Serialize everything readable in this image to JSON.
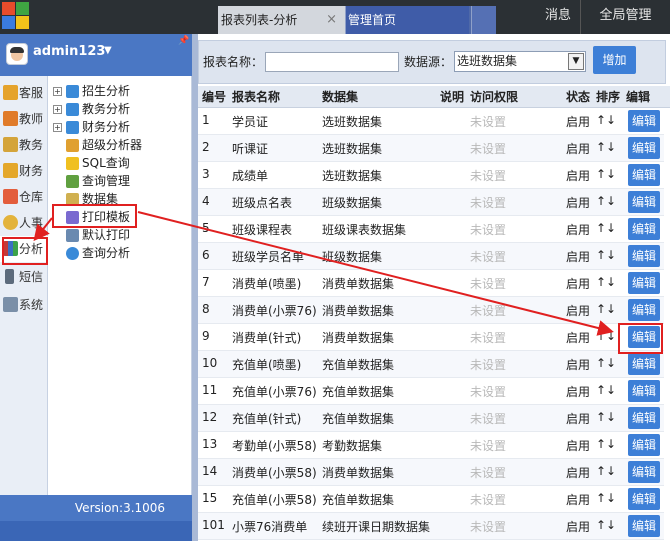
{
  "topbar": {
    "tabs": [
      {
        "label": "报表列表-分析",
        "close": "×",
        "active": true
      },
      {
        "label": "管理首页",
        "active": false
      }
    ],
    "links": {
      "messages": "消息",
      "settings": "全局管理"
    },
    "colors": {
      "background": "#2b3034",
      "active_tab": "#d3d7dd",
      "inactive_tab": "#3f5ca8"
    }
  },
  "user": {
    "name": "admin123",
    "dropdown_icon": "triangle-down-icon",
    "pin_icon": "pin-icon"
  },
  "sidebar": {
    "nav": [
      {
        "label": "客服",
        "icon": "customer-service-icon",
        "color": "#e5a32c"
      },
      {
        "label": "教师",
        "icon": "teacher-icon",
        "color": "#e07b2a"
      },
      {
        "label": "教务",
        "icon": "academic-icon",
        "color": "#d4a43a"
      },
      {
        "label": "财务",
        "icon": "finance-icon",
        "color": "#e4a72a"
      },
      {
        "label": "仓库",
        "icon": "warehouse-icon",
        "color": "#e35d3c"
      },
      {
        "label": "人事",
        "icon": "hr-icon",
        "color": "#e3b33b"
      },
      {
        "label": "分析",
        "icon": "analysis-icon",
        "color": "#c23a3a",
        "active": true
      },
      {
        "label": "短信",
        "icon": "sms-icon",
        "color": "#5d6b7c"
      },
      {
        "label": "系统",
        "icon": "system-icon",
        "color": "#7a8fa8"
      }
    ],
    "tree": [
      {
        "label": "招生分析",
        "expandable": true,
        "icon": "enrollment-analysis-icon"
      },
      {
        "label": "教务分析",
        "expandable": true,
        "icon": "academic-analysis-icon"
      },
      {
        "label": "财务分析",
        "expandable": true,
        "icon": "finance-analysis-icon"
      },
      {
        "label": "超级分析器",
        "expandable": false,
        "icon": "super-analyzer-icon"
      },
      {
        "label": "SQL查询",
        "expandable": false,
        "icon": "sql-query-icon"
      },
      {
        "label": "查询管理",
        "expandable": false,
        "icon": "query-management-icon"
      },
      {
        "label": "数据集",
        "expandable": false,
        "icon": "dataset-icon"
      },
      {
        "label": "打印模板",
        "expandable": false,
        "icon": "print-template-icon",
        "active": true
      },
      {
        "label": "默认打印",
        "expandable": false,
        "icon": "default-print-icon"
      },
      {
        "label": "查询分析",
        "expandable": false,
        "icon": "query-analysis-icon"
      }
    ],
    "version": "Version:3.1006"
  },
  "toolbar": {
    "name_label": "报表名称：",
    "name_value": "",
    "source_label": "数据源：",
    "source_value": "选班数据集",
    "add_label": "增加"
  },
  "table": {
    "headers": [
      "编号",
      "报表名称",
      "数据集",
      "说明",
      "访问权限",
      "状态",
      "排序",
      "编辑"
    ],
    "rows": [
      {
        "id": "1",
        "name": "学员证",
        "dataset": "选班数据集",
        "desc": "",
        "perm": "未设置",
        "status": "启用",
        "sort": "↑↓",
        "edit": "编辑"
      },
      {
        "id": "2",
        "name": "听课证",
        "dataset": "选班数据集",
        "desc": "",
        "perm": "未设置",
        "status": "启用",
        "sort": "↑↓",
        "edit": "编辑"
      },
      {
        "id": "3",
        "name": "成绩单",
        "dataset": "选班数据集",
        "desc": "",
        "perm": "未设置",
        "status": "启用",
        "sort": "↑↓",
        "edit": "编辑"
      },
      {
        "id": "4",
        "name": "班级点名表",
        "dataset": "班级数据集",
        "desc": "",
        "perm": "未设置",
        "status": "启用",
        "sort": "↑↓",
        "edit": "编辑"
      },
      {
        "id": "5",
        "name": "班级课程表",
        "dataset": "班级课表数据集",
        "desc": "",
        "perm": "未设置",
        "status": "启用",
        "sort": "↑↓",
        "edit": "编辑"
      },
      {
        "id": "6",
        "name": "班级学员名单",
        "dataset": "班级数据集",
        "desc": "",
        "perm": "未设置",
        "status": "启用",
        "sort": "↑↓",
        "edit": "编辑"
      },
      {
        "id": "7",
        "name": "消费单(喷墨)",
        "dataset": "消费单数据集",
        "desc": "",
        "perm": "未设置",
        "status": "启用",
        "sort": "↑↓",
        "edit": "编辑"
      },
      {
        "id": "8",
        "name": "消费单(小票76)",
        "dataset": "消费单数据集",
        "desc": "",
        "perm": "未设置",
        "status": "启用",
        "sort": "↑↓",
        "edit": "编辑"
      },
      {
        "id": "9",
        "name": "消费单(针式)",
        "dataset": "消费单数据集",
        "desc": "",
        "perm": "未设置",
        "status": "启用",
        "sort": "↑↓",
        "edit": "编辑",
        "highlighted": true
      },
      {
        "id": "10",
        "name": "充值单(喷墨)",
        "dataset": "充值单数据集",
        "desc": "",
        "perm": "未设置",
        "status": "启用",
        "sort": "↑↓",
        "edit": "编辑"
      },
      {
        "id": "11",
        "name": "充值单(小票76)",
        "dataset": "充值单数据集",
        "desc": "",
        "perm": "未设置",
        "status": "启用",
        "sort": "↑↓",
        "edit": "编辑"
      },
      {
        "id": "12",
        "name": "充值单(针式)",
        "dataset": "充值单数据集",
        "desc": "",
        "perm": "未设置",
        "status": "启用",
        "sort": "↑↓",
        "edit": "编辑"
      },
      {
        "id": "13",
        "name": "考勤单(小票58)",
        "dataset": "考勤数据集",
        "desc": "",
        "perm": "未设置",
        "status": "启用",
        "sort": "↑↓",
        "edit": "编辑"
      },
      {
        "id": "14",
        "name": "消费单(小票58)",
        "dataset": "消费单数据集",
        "desc": "",
        "perm": "未设置",
        "status": "启用",
        "sort": "↑↓",
        "edit": "编辑"
      },
      {
        "id": "15",
        "name": "充值单(小票58)",
        "dataset": "充值单数据集",
        "desc": "",
        "perm": "未设置",
        "status": "启用",
        "sort": "↑↓",
        "edit": "编辑"
      },
      {
        "id": "101",
        "name": "小票76消费单",
        "dataset": "续班开课日期数据集",
        "desc": "",
        "perm": "未设置",
        "status": "启用",
        "sort": "↑↓",
        "edit": "编辑"
      }
    ]
  },
  "colors": {
    "accent": "#3d7fd7",
    "sidebar": "#4a77c4",
    "highlight": "#e02020"
  }
}
